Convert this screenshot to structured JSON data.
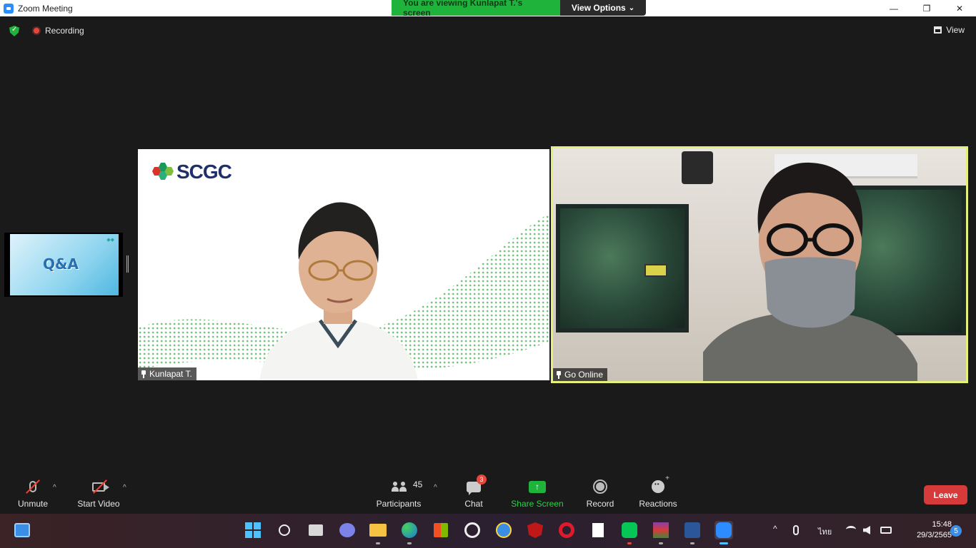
{
  "window": {
    "title": "Zoom Meeting",
    "min_glyph": "—",
    "restore_glyph": "❐",
    "close_glyph": "✕"
  },
  "banner": {
    "viewing_text": "You are viewing Kunlapat T.'s screen",
    "view_options_label": "View Options",
    "chevron_glyph": "⌄"
  },
  "top": {
    "recording_label": "Recording",
    "view_label": "View"
  },
  "thumbnail": {
    "slide_text": "Q&A"
  },
  "tiles": {
    "left": {
      "name": "Kunlapat T.",
      "logo_text": "SCGC"
    },
    "right": {
      "name": "Go Online"
    }
  },
  "toolbar": {
    "unmute_label": "Unmute",
    "start_video_label": "Start Video",
    "participants_label": "Participants",
    "participants_count": "45",
    "chat_label": "Chat",
    "chat_badge": "3",
    "share_label": "Share Screen",
    "record_label": "Record",
    "reactions_label": "Reactions",
    "leave_label": "Leave",
    "caret_glyph": "^",
    "share_arrow": "↑"
  },
  "taskbar": {
    "time": "15:48",
    "date": "29/3/2565",
    "lang": "ไทย",
    "notifications": "5",
    "chevron_glyph": "^"
  },
  "colors": {
    "accent_green": "#1fb33b",
    "leave_red": "#d73a3a",
    "active_speaker_border": "#e4f07a",
    "scgc_navy": "#1f2f6b"
  }
}
